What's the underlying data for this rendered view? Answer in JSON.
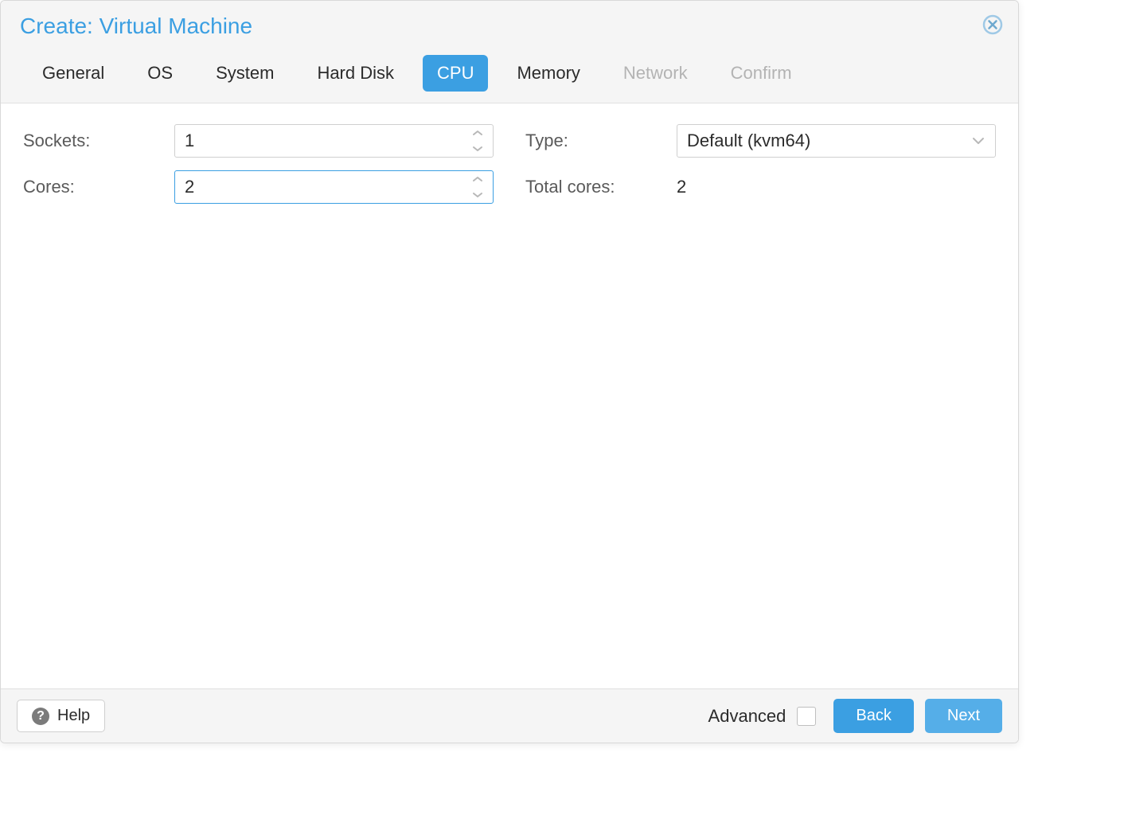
{
  "dialog": {
    "title": "Create: Virtual Machine"
  },
  "tabs": {
    "general": "General",
    "os": "OS",
    "system": "System",
    "hard_disk": "Hard Disk",
    "cpu": "CPU",
    "memory": "Memory",
    "network": "Network",
    "confirm": "Confirm"
  },
  "form": {
    "sockets_label": "Sockets:",
    "sockets_value": "1",
    "cores_label": "Cores:",
    "cores_value": "2",
    "type_label": "Type:",
    "type_value": "Default (kvm64)",
    "total_cores_label": "Total cores:",
    "total_cores_value": "2"
  },
  "footer": {
    "help_label": "Help",
    "advanced_label": "Advanced",
    "back_label": "Back",
    "next_label": "Next"
  }
}
